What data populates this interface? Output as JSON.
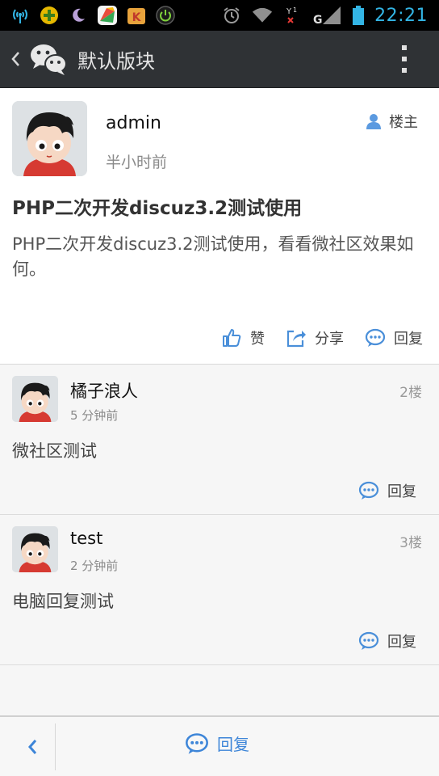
{
  "status_bar": {
    "time": "22:21",
    "icons": [
      "wifi-antenna-icon",
      "plus-app-icon",
      "moon-icon",
      "colorful-app-icon",
      "game-app-icon",
      "power-icon",
      "alarm-icon",
      "wifi-icon",
      "signal-no-sim-icon",
      "signal-g-icon",
      "battery-icon"
    ],
    "time_color": "#33b5e5"
  },
  "header": {
    "title": "默认版块",
    "back_icon": "chevron-left-icon",
    "logo_icon": "wechat-logo-icon",
    "more_icon": "more-vert-icon"
  },
  "post": {
    "author": "admin",
    "time": "半小时前",
    "op_label": "楼主",
    "title": "PHP二次开发discuz3.2测试使用",
    "body": "PHP二次开发discuz3.2测试使用，看看微社区效果如何。",
    "actions": {
      "like": "赞",
      "share": "分享",
      "reply": "回复"
    }
  },
  "replies": [
    {
      "author": "橘子浪人",
      "time": "5 分钟前",
      "floor": "2楼",
      "content": "微社区测试",
      "reply_label": "回复"
    },
    {
      "author": "test",
      "time": "2 分钟前",
      "floor": "3楼",
      "content": "电脑回复测试",
      "reply_label": "回复"
    }
  ],
  "bottom_bar": {
    "reply_label": "回复",
    "accent": "#3d85d8"
  },
  "colors": {
    "header_bg": "#2f3235",
    "icon_blue": "#4a8fd9"
  }
}
